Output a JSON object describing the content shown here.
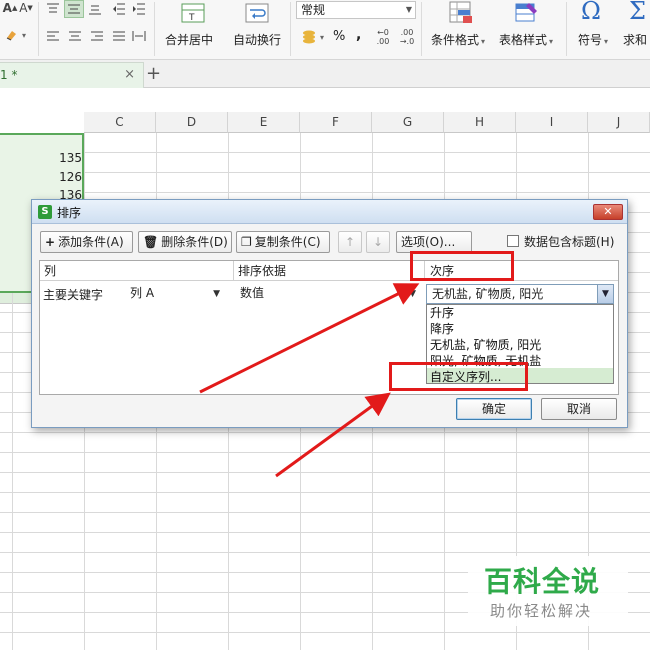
{
  "ribbon": {
    "merge_center": "合并居中",
    "wrap_text": "自动换行",
    "number_format": "常规",
    "percent_symbol": "%",
    "thousands_symbol": ",",
    "inc_decimal": ".00\n→.0",
    "cond_format": "条件格式",
    "table_style": "表格样式",
    "symbol": "符号",
    "sum": "求和",
    "omega": "Ω",
    "sigma": "Σ",
    "font_grow": "A",
    "font_shrink": "A"
  },
  "tabs": {
    "doc_tab_label": "1 *",
    "close_glyph": "×",
    "new_tab_glyph": "+"
  },
  "columns": [
    "C",
    "D",
    "E",
    "F",
    "G",
    "H",
    "I",
    "J"
  ],
  "cells": [
    "135",
    "126",
    "136"
  ],
  "dialog": {
    "title": "排序",
    "close_glyph": "✕",
    "add_condition": "添加条件(A)",
    "delete_condition": "删除条件(D)",
    "copy_condition": "复制条件(C)",
    "move_up": "↑",
    "move_down": "↓",
    "options": "选项(O)...",
    "header_checkbox_label": "数据包含标题(H)",
    "col_header": "列",
    "sort_on_header": "排序依据",
    "order_header": "次序",
    "primary_key_label": "主要关键字",
    "column_value": "列 A",
    "sort_on_value": "数值",
    "order_value": "无机盐, 矿物质, 阳光",
    "dropdown_options": [
      "升序",
      "降序",
      "无机盐, 矿物质, 阳光",
      "阳光, 矿物质, 无机盐",
      "自定义序列..."
    ],
    "ok": "确定",
    "cancel": "取消"
  },
  "watermark": {
    "brand": "百科全说",
    "slogan": "助你轻松解决"
  },
  "colors": {
    "accent_green": "#5aa85a",
    "annotation_red": "#e21a1a",
    "brand_green": "#2faa4a"
  }
}
